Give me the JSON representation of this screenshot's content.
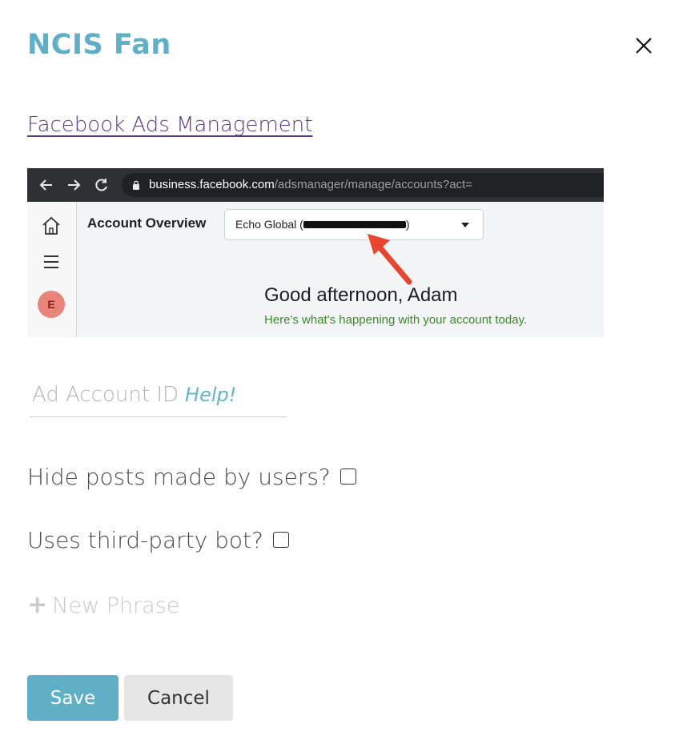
{
  "modal": {
    "title": "NCIS Fan"
  },
  "link": {
    "label": "Facebook Ads Management"
  },
  "screenshot": {
    "url_host": "business.facebook.com",
    "url_path": "/adsmanager/manage/accounts?act=",
    "account_label": "Account Overview",
    "account_value_prefix": "Echo Global (",
    "account_value_suffix": ")",
    "avatar_letter": "E",
    "greeting": "Good afternoon, Adam",
    "subtext": "Here's what's happening with your account today.",
    "arrow_color": "#e8442e"
  },
  "form": {
    "ad_account_placeholder": "Ad Account ID",
    "help_label": "Help!",
    "hide_posts_label": "Hide posts made by users?",
    "hide_posts_checked": false,
    "third_party_label": "Uses third-party bot?",
    "third_party_checked": false,
    "new_phrase_label": "New Phrase"
  },
  "buttons": {
    "save_label": "Save",
    "cancel_label": "Cancel"
  },
  "colors": {
    "accent": "#5fb0c6",
    "link": "#5a3a8a"
  }
}
